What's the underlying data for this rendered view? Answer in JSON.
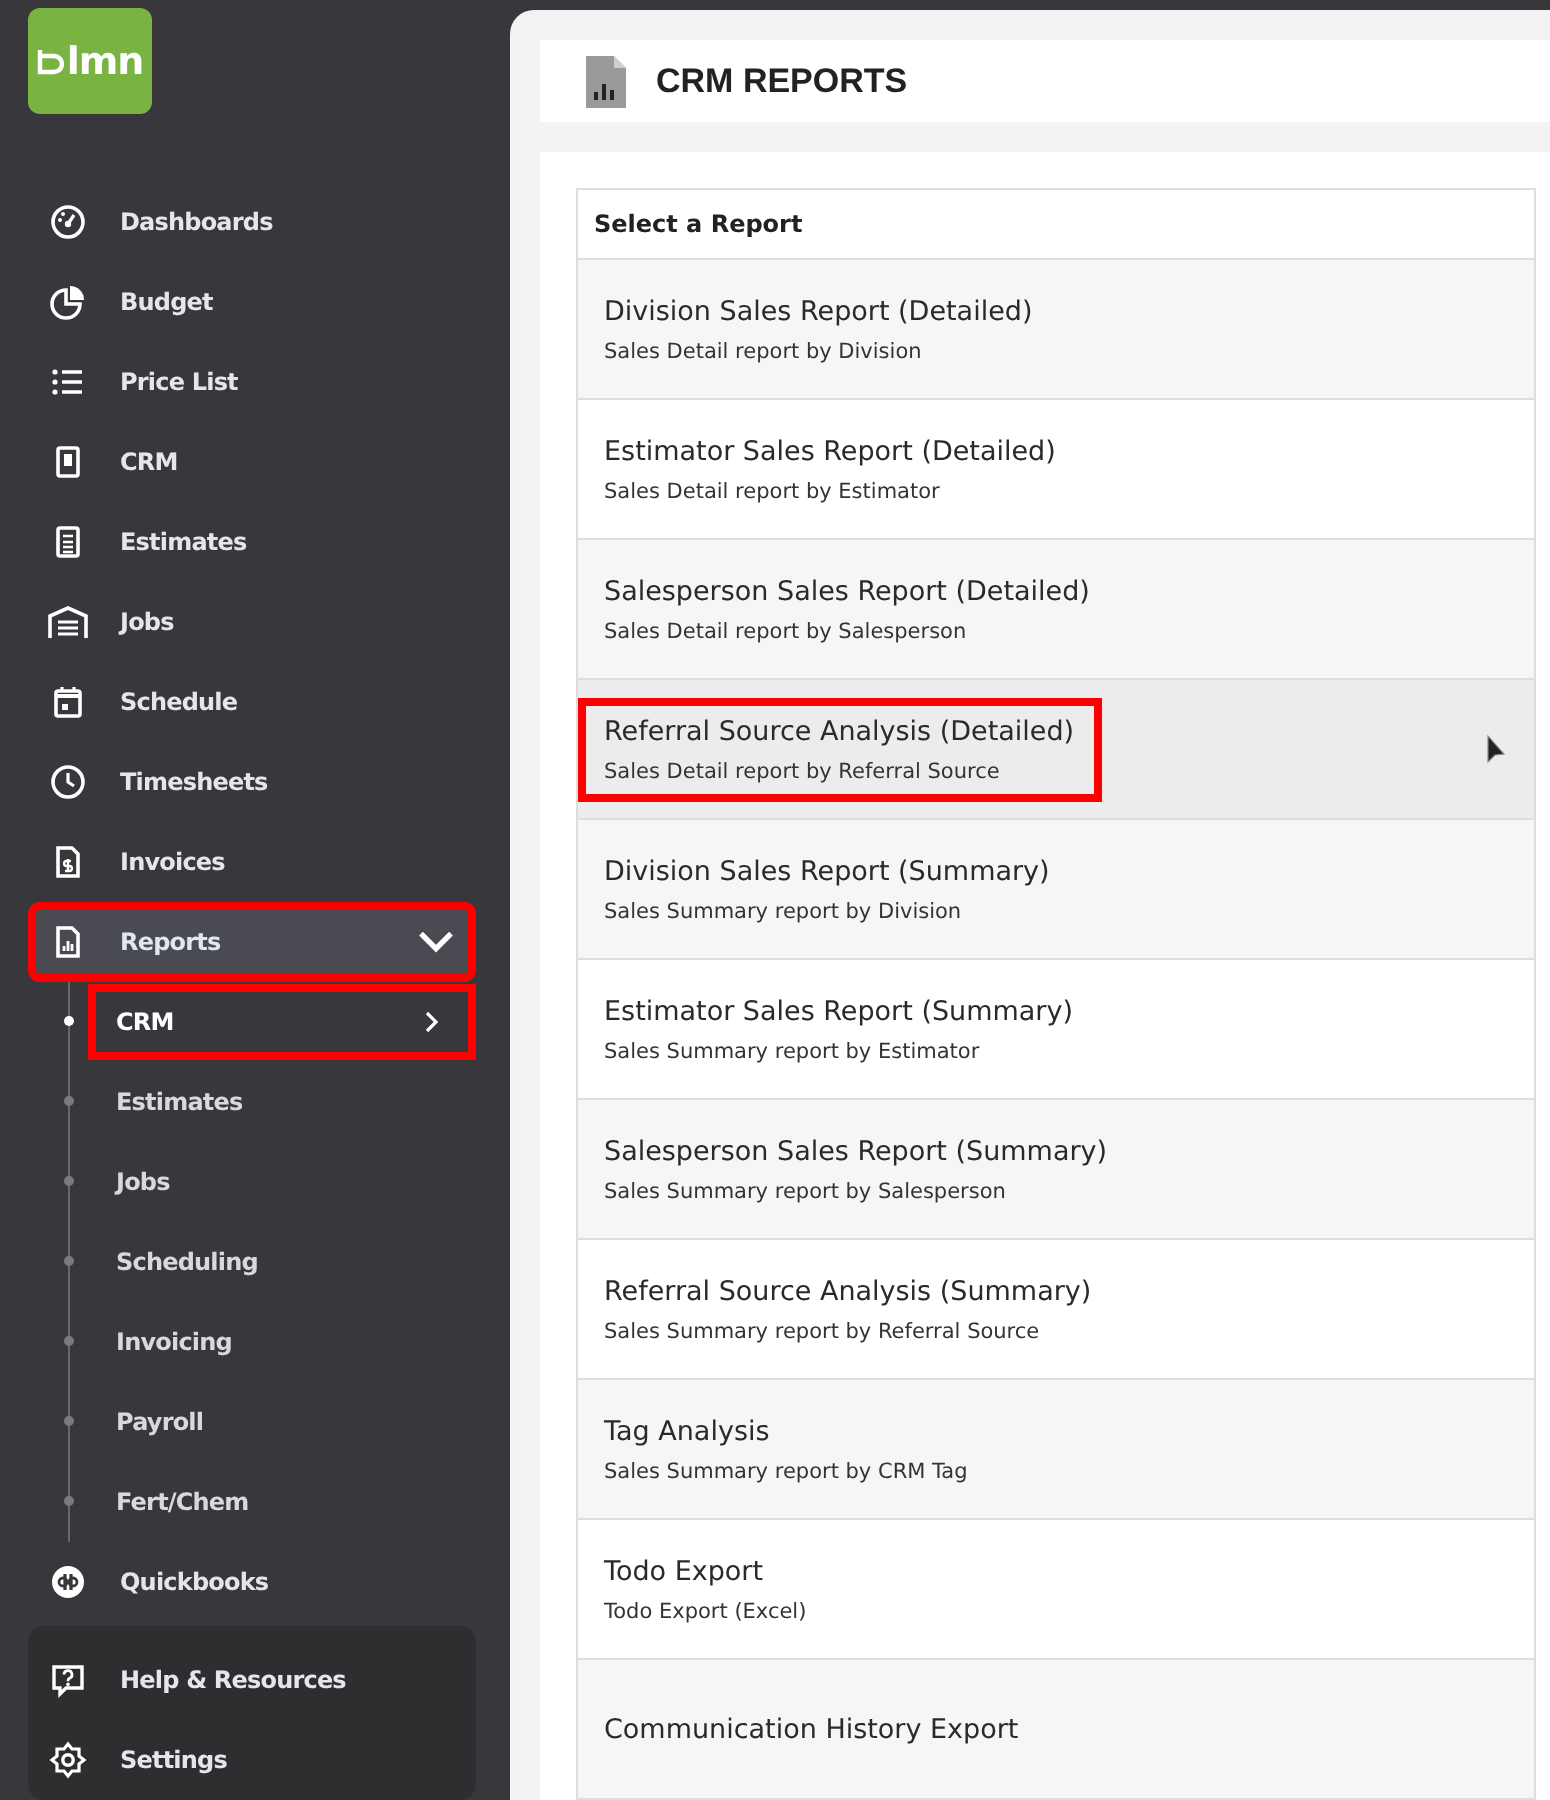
{
  "logo": {
    "text": "lmn"
  },
  "sidebar": {
    "items": [
      {
        "label": "Dashboards",
        "expanded": false,
        "highlighted": false
      },
      {
        "label": "Budget",
        "expanded": false,
        "highlighted": false
      },
      {
        "label": "Price List",
        "expanded": false,
        "highlighted": false
      },
      {
        "label": "CRM",
        "expanded": false,
        "highlighted": false
      },
      {
        "label": "Estimates",
        "expanded": false,
        "highlighted": false
      },
      {
        "label": "Jobs",
        "expanded": false,
        "highlighted": false
      },
      {
        "label": "Schedule",
        "expanded": false,
        "highlighted": false
      },
      {
        "label": "Timesheets",
        "expanded": false,
        "highlighted": false
      },
      {
        "label": "Invoices",
        "expanded": false,
        "highlighted": false
      },
      {
        "label": "Reports",
        "expanded": true,
        "highlighted": true,
        "children": [
          {
            "label": "CRM",
            "selected": true,
            "highlighted": true
          },
          {
            "label": "Estimates",
            "selected": false,
            "highlighted": false
          },
          {
            "label": "Jobs",
            "selected": false,
            "highlighted": false
          },
          {
            "label": "Scheduling",
            "selected": false,
            "highlighted": false
          },
          {
            "label": "Invoicing",
            "selected": false,
            "highlighted": false
          },
          {
            "label": "Payroll",
            "selected": false,
            "highlighted": false
          },
          {
            "label": "Fert/Chem",
            "selected": false,
            "highlighted": false
          }
        ]
      },
      {
        "label": "Quickbooks",
        "expanded": false,
        "highlighted": false
      }
    ],
    "bottom_items": [
      {
        "label": "Help & Resources"
      },
      {
        "label": "Settings"
      }
    ]
  },
  "page": {
    "title": "CRM REPORTS"
  },
  "report_list": {
    "heading": "Select a Report",
    "rows": [
      {
        "title": "Division Sales Report (Detailed)",
        "description": "Sales Detail report by Division",
        "hovered": false,
        "highlighted": false
      },
      {
        "title": "Estimator Sales Report (Detailed)",
        "description": "Sales Detail report by Estimator",
        "hovered": false,
        "highlighted": false
      },
      {
        "title": "Salesperson Sales Report (Detailed)",
        "description": "Sales Detail report by Salesperson",
        "hovered": false,
        "highlighted": false
      },
      {
        "title": "Referral Source Analysis (Detailed)",
        "description": "Sales Detail report by Referral Source",
        "hovered": true,
        "highlighted": true
      },
      {
        "title": "Division Sales Report (Summary)",
        "description": "Sales Summary report by Division",
        "hovered": false,
        "highlighted": false
      },
      {
        "title": "Estimator Sales Report (Summary)",
        "description": "Sales Summary report by Estimator",
        "hovered": false,
        "highlighted": false
      },
      {
        "title": "Salesperson Sales Report (Summary)",
        "description": "Sales Summary report by Salesperson",
        "hovered": false,
        "highlighted": false
      },
      {
        "title": "Referral Source Analysis (Summary)",
        "description": "Sales Summary report by Referral Source",
        "hovered": false,
        "highlighted": false
      },
      {
        "title": "Tag Analysis",
        "description": "Sales Summary report by CRM Tag",
        "hovered": false,
        "highlighted": false
      },
      {
        "title": "Todo Export",
        "description": "Todo Export (Excel)",
        "hovered": false,
        "highlighted": false
      },
      {
        "title": "Communication History Export",
        "hovered": false,
        "highlighted": false
      }
    ]
  }
}
